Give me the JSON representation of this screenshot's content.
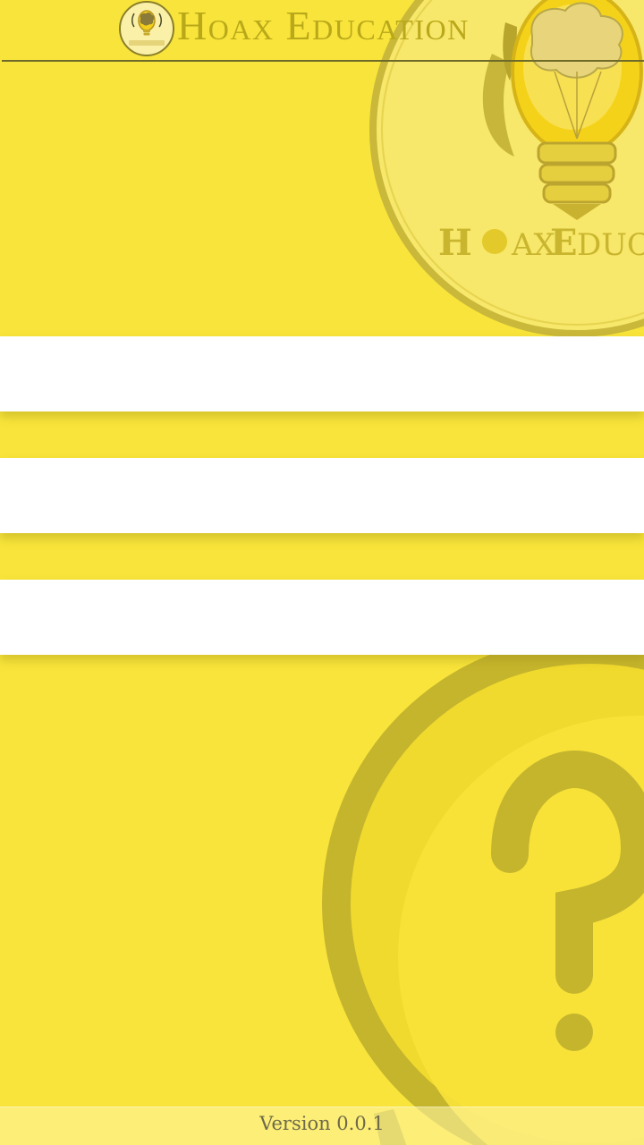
{
  "header": {
    "title": "Hoax Education"
  },
  "menu": {
    "items": [
      {
        "label": ""
      },
      {
        "label": ""
      },
      {
        "label": ""
      }
    ]
  },
  "footer": {
    "version": "Version 0.0.1"
  },
  "colors": {
    "background": "#f8e43a",
    "accent": "#c7b62b",
    "header_line": "#6e6a2a",
    "menu_bar": "#ffffff",
    "version_text": "#6e6a4a"
  },
  "icons": {
    "header_logo": "lightbulb-brain-icon",
    "hero_emblem": "hoax-education-emblem",
    "background_graphic": "question-mark-icon"
  }
}
